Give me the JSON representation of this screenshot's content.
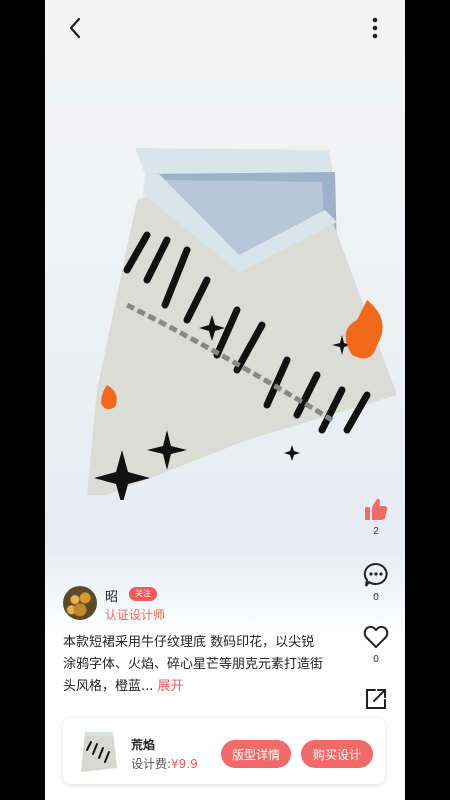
{
  "nav": {
    "back_icon": "chevron-left-icon",
    "more_icon": "more-vertical-icon"
  },
  "actions": {
    "like_count": "2",
    "comment_count": "0",
    "favorite_count": "0"
  },
  "designer": {
    "name": "昭",
    "follow_label": "关注",
    "title": "认证设计师"
  },
  "description": {
    "text": "本款短裙采用牛仔纹理底 数码印花，以尖锐涂鸦字体、火焰、碎心星芒等朋克元素打造街头风格，橙蓝...",
    "expand_label": "展开"
  },
  "product": {
    "name": "荒焰",
    "fee_label": "设计费:",
    "price": "¥9.9",
    "detail_button": "版型详情",
    "buy_button": "购买设计"
  },
  "colors": {
    "accent": "#f05a5a",
    "accent_soft": "#f06a6a"
  }
}
